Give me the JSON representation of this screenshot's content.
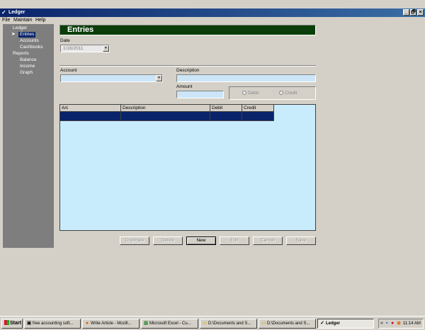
{
  "window": {
    "title": "Ledger",
    "controls": [
      "_",
      "🗗",
      "×"
    ]
  },
  "menu": [
    "File",
    "Maintain",
    "Help"
  ],
  "sidebar": {
    "groups": [
      {
        "label": "Ledger",
        "items": [
          "Entries",
          "Accounts",
          "Cashbooks"
        ]
      },
      {
        "label": "Reports",
        "items": [
          "Balance",
          "Income",
          "Graph"
        ]
      }
    ],
    "active": "Entries"
  },
  "page": {
    "title": "Entries",
    "date_label": "Date",
    "date_value": "1/16/2011",
    "account_label": "Account",
    "account_value": "",
    "description_label": "Description",
    "description_value": "",
    "amount_label": "Amount",
    "amount_value": "",
    "radio_debit": "Debit",
    "radio_credit": "Credit"
  },
  "grid": {
    "columns": [
      "A/c",
      "Description",
      "Debit",
      "Credit"
    ]
  },
  "buttons": {
    "duplicate": "Duplicate",
    "delete": "Delete",
    "new": "New",
    "edit": "Edit",
    "cancel": "Cancel",
    "save": "Save"
  },
  "taskbar": {
    "start": "Start",
    "tasks": [
      "free accounting soft...",
      "Write Article - Mozill...",
      "Microsoft Excel - Cu...",
      "D:\\Documents and S...",
      "D:\\Documents and S...",
      "Ledger"
    ],
    "clock": "11:14 AM"
  }
}
